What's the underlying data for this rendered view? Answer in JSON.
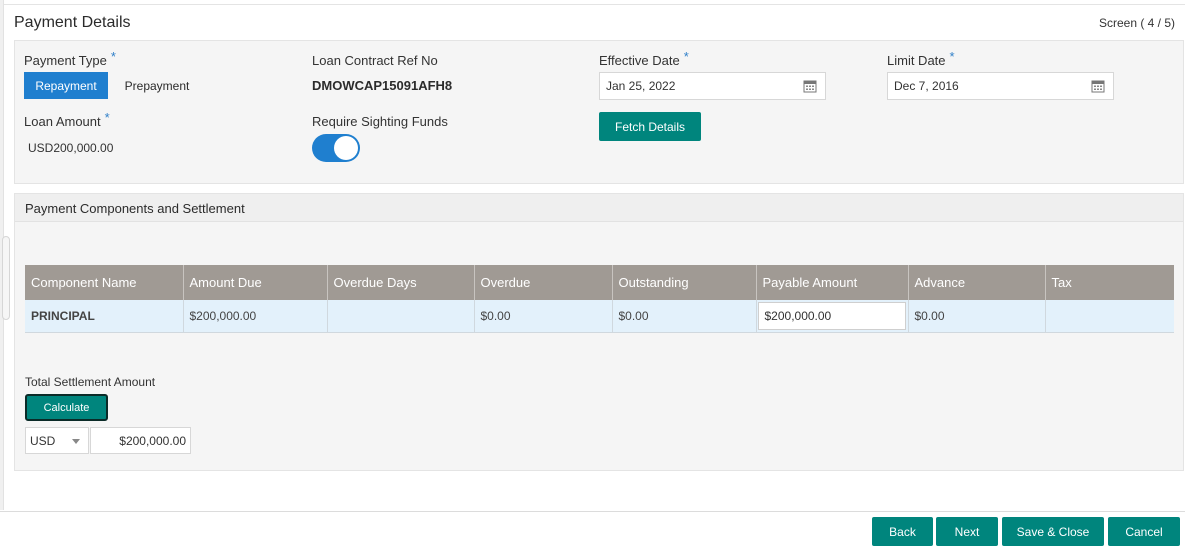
{
  "header": {
    "title": "Payment Details",
    "screen_indicator": "Screen ( 4 / 5)"
  },
  "payment_details": {
    "payment_type": {
      "label": "Payment Type",
      "required": "*",
      "options": [
        "Repayment",
        "Prepayment"
      ],
      "selected": "Repayment"
    },
    "loan_contract_ref": {
      "label": "Loan Contract Ref No",
      "value": "DMOWCAP15091AFH8"
    },
    "effective_date": {
      "label": "Effective Date",
      "required": "*",
      "value": "Jan 25, 2022"
    },
    "limit_date": {
      "label": "Limit Date",
      "required": "*",
      "value": "Dec 7, 2016"
    },
    "loan_amount": {
      "label": "Loan Amount",
      "required": "*",
      "value": "USD200,000.00"
    },
    "require_sighting_funds": {
      "label": "Require Sighting Funds",
      "enabled": true
    },
    "fetch_details_label": "Fetch Details"
  },
  "components": {
    "section_title": "Payment Components and Settlement",
    "columns": [
      "Component Name",
      "Amount Due",
      "Overdue Days",
      "Overdue",
      "Outstanding",
      "Payable Amount",
      "Advance",
      "Tax"
    ],
    "rows": [
      {
        "component_name": "PRINCIPAL",
        "amount_due": "$200,000.00",
        "overdue_days": "",
        "overdue": "$0.00",
        "outstanding": "$0.00",
        "payable_amount": "$200,000.00",
        "advance": "$0.00",
        "tax": ""
      }
    ],
    "total_settlement_label": "Total Settlement Amount",
    "calculate_label": "Calculate",
    "currency": "USD",
    "total_amount": "$200,000.00"
  },
  "footer": {
    "back_label": "Back",
    "next_label": "Next",
    "save_close_label": "Save & Close",
    "cancel_label": "Cancel"
  },
  "colors": {
    "accent_teal": "#00857d",
    "active_blue": "#1f7fcf",
    "required_blue": "#2f7fc8",
    "table_header": "#a09a94",
    "row_highlight": "#e3f1fb"
  }
}
